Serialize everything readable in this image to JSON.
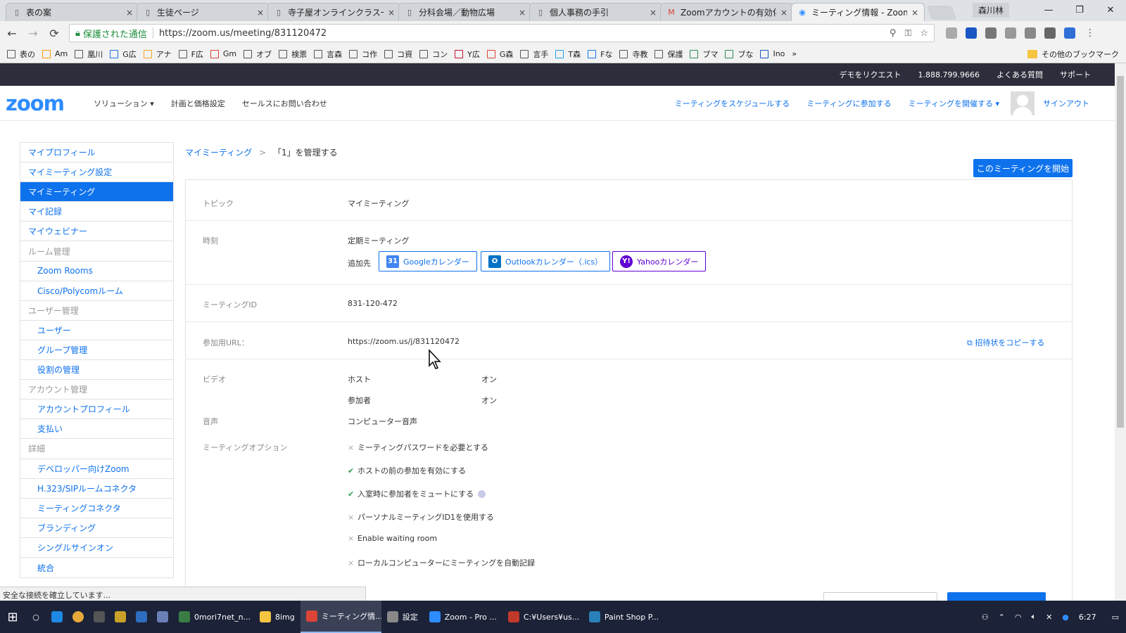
{
  "browser": {
    "tabs": [
      {
        "title": "表の案",
        "icon": "document-icon"
      },
      {
        "title": "生徒ページ",
        "icon": "document-icon"
      },
      {
        "title": "寺子屋オンラインクラス一覧",
        "icon": "document-icon"
      },
      {
        "title": "分科会場／動物広場",
        "icon": "document-icon"
      },
      {
        "title": "個人事務の手引",
        "icon": "document-icon"
      },
      {
        "title": "Zoomアカウントの有効化 -",
        "icon": "gmail-icon"
      },
      {
        "title": "ミーティング情報 - Zoom",
        "icon": "zoom-icon",
        "active": true
      }
    ],
    "tab_close": "×",
    "profile_name": "森川林",
    "window_controls": [
      "—",
      "❐",
      "✕"
    ],
    "address": {
      "secure_label": "保護された通信",
      "url": "https://zoom.us/meeting/831120472"
    },
    "nav": {
      "back": "←",
      "forward": "→",
      "reload": "⟳"
    },
    "omni_icons": [
      "⚲",
      "⚿",
      "☆"
    ],
    "bookmarks": [
      "表の",
      "Am",
      "凰川",
      "G広",
      "アナ",
      "F広",
      "Gm",
      "オブ",
      "検票",
      "言森",
      "コ作",
      "コ資",
      "コン",
      "Y広",
      "G森",
      "言手",
      "T森",
      "Fな",
      "寺教",
      "保護",
      "ブマ",
      "ブな",
      "Ino"
    ],
    "bookmarks_overflow": "»",
    "other_bookmarks": "その他のブックマーク"
  },
  "zoom": {
    "topstrip": [
      "デモをリクエスト",
      "1.888.799.9666",
      "よくある質問",
      "サポート"
    ],
    "logo": "zoom",
    "main_nav": [
      "ソリューション ▾",
      "計画と価格設定",
      "セールスにお問い合わせ"
    ],
    "right_nav": [
      "ミーティングをスケジュールする",
      "ミーティングに参加する",
      "ミーティングを開催する ▾"
    ],
    "signout": "サインアウト",
    "sidebar": [
      {
        "label": "マイプロフィール",
        "type": "link"
      },
      {
        "label": "マイミーティング設定",
        "type": "link"
      },
      {
        "label": "マイミーティング",
        "type": "active"
      },
      {
        "label": "マイ記録",
        "type": "link"
      },
      {
        "label": "マイウェビナー",
        "type": "link"
      },
      {
        "label": "ルーム管理",
        "type": "head"
      },
      {
        "label": "Zoom Rooms",
        "type": "sub"
      },
      {
        "label": "Cisco/Polycomルーム",
        "type": "sub"
      },
      {
        "label": "ユーザー管理",
        "type": "head"
      },
      {
        "label": "ユーザー",
        "type": "sub"
      },
      {
        "label": "グループ管理",
        "type": "sub"
      },
      {
        "label": "役割の管理",
        "type": "sub"
      },
      {
        "label": "アカウント管理",
        "type": "head"
      },
      {
        "label": "アカウントプロフィール",
        "type": "sub"
      },
      {
        "label": "支払い",
        "type": "sub"
      },
      {
        "label": "詳細",
        "type": "head"
      },
      {
        "label": "デベロッパー向けZoom",
        "type": "sub"
      },
      {
        "label": "H.323/SIPルームコネクタ",
        "type": "sub"
      },
      {
        "label": "ミーティングコネクタ",
        "type": "sub"
      },
      {
        "label": "ブランディング",
        "type": "sub"
      },
      {
        "label": "シングルサインオン",
        "type": "sub"
      },
      {
        "label": "統合",
        "type": "sub"
      }
    ],
    "breadcrumb": {
      "parent": "マイミーティング",
      "sep": ">",
      "current": "「1」を管理する"
    },
    "start_button": "このミーティングを開始",
    "meeting": {
      "topic_label": "トピック",
      "topic": "マイミーティング",
      "time_label": "時刻",
      "time": "定期ミーティング",
      "add_to": "追加先",
      "calendars": [
        {
          "label": "Googleカレンダー",
          "icon_text": "31",
          "color": "#4285f4"
        },
        {
          "label": "Outlookカレンダー（.ics）",
          "icon_text": "O",
          "color": "#0072c6"
        },
        {
          "label": "Yahooカレンダー",
          "icon_text": "Y!",
          "color": "#6001d2"
        }
      ],
      "id_label": "ミーティングID",
      "id": "831-120-472",
      "url_label": "参加用URL：",
      "join_url": "https://zoom.us/j/831120472",
      "copy_invite": "招待状をコピーする",
      "video_label": "ビデオ",
      "host_label": "ホスト",
      "host_value": "オン",
      "participant_label": "参加者",
      "participant_value": "オン",
      "audio_label": "音声",
      "audio": "コンピューター音声",
      "options_label": "ミーティングオプション",
      "options": [
        {
          "text": "ミーティングパスワードを必要とする",
          "on": false
        },
        {
          "text": "ホストの前の参加を有効にする",
          "on": true
        },
        {
          "text": "入室時に参加者をミュートにする",
          "on": true,
          "help": true
        },
        {
          "text": "パーソナルミーティングID1を使用する",
          "on": false
        },
        {
          "text": "Enable waiting room",
          "on": false
        },
        {
          "text": "ローカルコンピューターにミーティングを自動記録",
          "on": false
        }
      ]
    }
  },
  "status_text": "安全な接続を確立しています...",
  "taskbar": {
    "apps": [
      {
        "label": "0mori7net_n...",
        "color": "#3a7d44"
      },
      {
        "label": "8img",
        "color": "#f5c542"
      },
      {
        "label": "ミーティング情...",
        "color": "#db4437",
        "active": true
      },
      {
        "label": "設定",
        "color": "#888888"
      },
      {
        "label": "Zoom - Pro ...",
        "color": "#2d8cff"
      },
      {
        "label": "C:¥Users¥us...",
        "color": "#c0392b"
      },
      {
        "label": "Paint Shop P...",
        "color": "#2980b9"
      }
    ],
    "clock": "6:27"
  }
}
